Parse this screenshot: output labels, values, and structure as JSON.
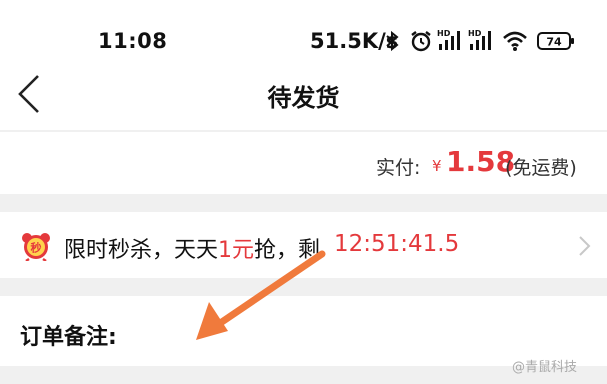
{
  "status_bar": {
    "time": "11:08",
    "net_speed": "51.5K/s",
    "battery": "74",
    "icons": [
      "bluetooth-icon",
      "alarm-icon",
      "hd-signal-icon",
      "hd-signal-icon",
      "wifi-icon",
      "battery-icon"
    ]
  },
  "header": {
    "title": "待发货",
    "back_icon": "chevron-left-icon"
  },
  "payment": {
    "label": "实付:",
    "currency": "¥",
    "amount": "1.58",
    "note": "(免运费)"
  },
  "flash_sale": {
    "icon": "alarm-clock-icon",
    "badge_char": "秒",
    "text_prefix": "限时秒杀，天天",
    "text_highlight": "1元",
    "text_suffix": "抢，剩",
    "countdown": "12:51:41.5"
  },
  "order_remark": {
    "label": "订单备注:"
  },
  "watermark": "@青鼠科技",
  "colors": {
    "accent": "#e4393c",
    "annotation_arrow": "#f07a3c",
    "background": "#f0f0f0"
  }
}
